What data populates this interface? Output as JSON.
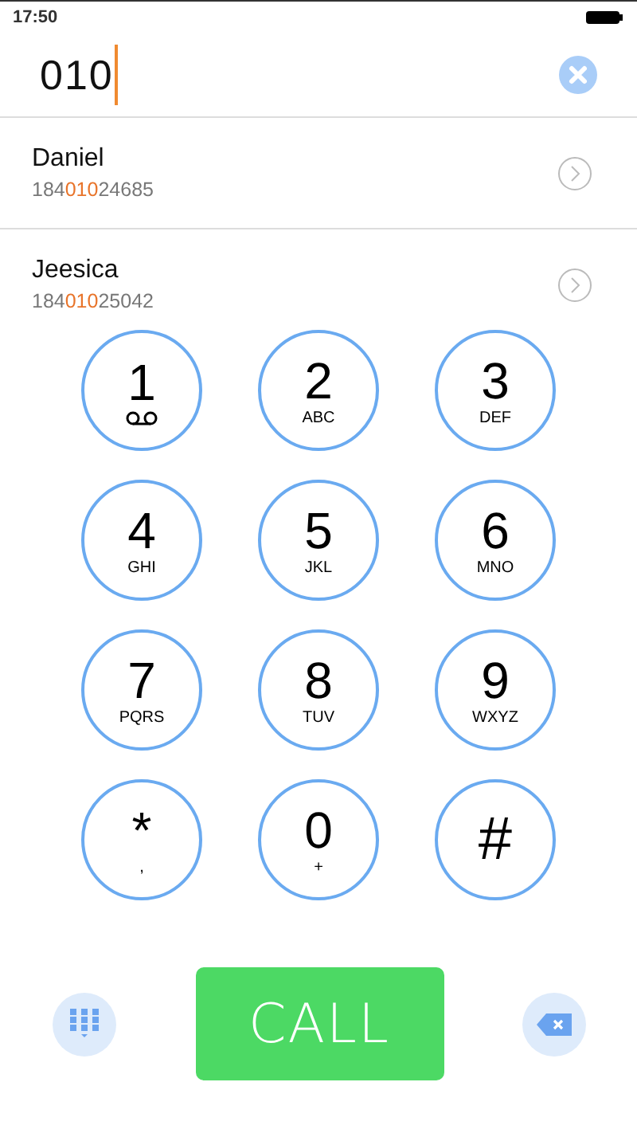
{
  "status_bar": {
    "time": "17:50"
  },
  "dial_input": {
    "value": "010"
  },
  "contacts": [
    {
      "name": "Daniel",
      "number": [
        {
          "text": "184",
          "match": false
        },
        {
          "text": "010",
          "match": true
        },
        {
          "text": "24685",
          "match": false
        }
      ]
    },
    {
      "name": "Jeesica",
      "number": [
        {
          "text": "184",
          "match": false
        },
        {
          "text": "010",
          "match": true
        },
        {
          "text": "25042",
          "match": false
        }
      ]
    }
  ],
  "keys": [
    {
      "kind": "voicemail",
      "digit": "1"
    },
    {
      "kind": "letters",
      "digit": "2",
      "sub": "ABC"
    },
    {
      "kind": "letters",
      "digit": "3",
      "sub": "DEF"
    },
    {
      "kind": "letters",
      "digit": "4",
      "sub": "GHI"
    },
    {
      "kind": "letters",
      "digit": "5",
      "sub": "JKL"
    },
    {
      "kind": "letters",
      "digit": "6",
      "sub": "MNO"
    },
    {
      "kind": "letters",
      "digit": "7",
      "sub": "PQRS"
    },
    {
      "kind": "letters",
      "digit": "8",
      "sub": "TUV"
    },
    {
      "kind": "letters",
      "digit": "9",
      "sub": "WXYZ"
    },
    {
      "kind": "letters",
      "digit": "*",
      "sub": ","
    },
    {
      "kind": "letters",
      "digit": "0",
      "sub": "+"
    },
    {
      "kind": "letters",
      "digit": "#"
    }
  ],
  "call_button": {
    "label": "CALL"
  }
}
